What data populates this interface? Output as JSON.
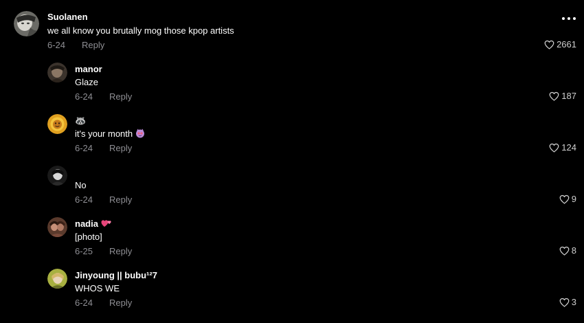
{
  "comments": [
    {
      "username": "Suolanen",
      "text": "we all know you brutally mog those kpop artists",
      "date": "6-24",
      "reply_label": "Reply",
      "likes": "2661"
    }
  ],
  "replies": [
    {
      "username": "manor",
      "text": "Glaze",
      "date": "6-24",
      "reply_label": "Reply",
      "likes": "187"
    },
    {
      "username": "🦝",
      "text": "it's your month",
      "date": "6-24",
      "reply_label": "Reply",
      "likes": "124"
    },
    {
      "username": "",
      "text": "No",
      "date": "6-24",
      "reply_label": "Reply",
      "likes": "9"
    },
    {
      "username": "nadia",
      "text": "[photo]",
      "date": "6-25",
      "reply_label": "Reply",
      "likes": "8"
    },
    {
      "username": "Jinyoung || bubu¹²7",
      "text": "WHOS WE",
      "date": "6-24",
      "reply_label": "Reply",
      "likes": "3"
    }
  ],
  "icons": {
    "more": "more-options-icon",
    "like": "heart-outline-icon"
  },
  "colors": {
    "background": "#000000",
    "text": "#ffffff",
    "muted": "#8e8e93",
    "heart_emoji": "#e8457a"
  }
}
